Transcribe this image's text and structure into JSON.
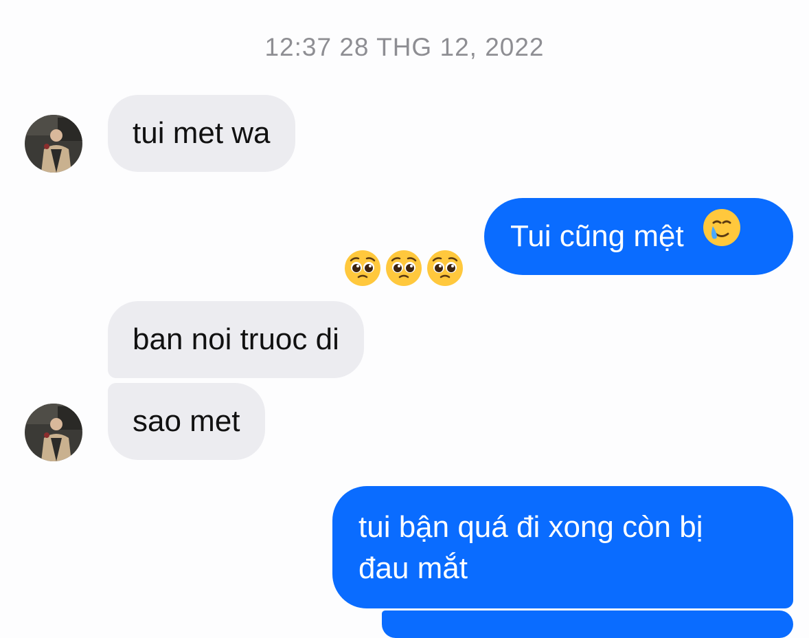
{
  "conversation": {
    "timestamp": "12:37 28 THG 12, 2022",
    "messages": [
      {
        "sender": "them",
        "text": "tui met wa"
      },
      {
        "sender": "me",
        "text": "Tui cũng mệt",
        "emoji": "crying-smile-emoji"
      },
      {
        "sender": "them",
        "text": "ban noi truoc di"
      },
      {
        "sender": "them",
        "text": "sao met"
      },
      {
        "sender": "me",
        "text_line1": "tui bận quá đi xong còn bị",
        "text_line2": "đau mắt"
      }
    ],
    "reactions": [
      "pleading-face-emoji",
      "pleading-face-emoji",
      "pleading-face-emoji"
    ]
  },
  "colors": {
    "sent_bubble": "#0a6cff",
    "received_bubble": "#ececf0",
    "timestamp_text": "#8e8e93"
  }
}
